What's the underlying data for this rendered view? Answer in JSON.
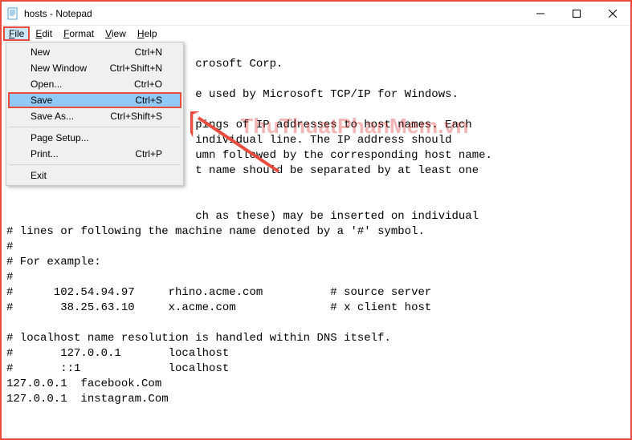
{
  "titlebar": {
    "title": "hosts - Notepad"
  },
  "menubar": {
    "file": "File",
    "edit": "Edit",
    "format": "Format",
    "view": "View",
    "help": "Help"
  },
  "dropdown": {
    "new_label": "New",
    "new_accel": "Ctrl+N",
    "newwin_label": "New Window",
    "newwin_accel": "Ctrl+Shift+N",
    "open_label": "Open...",
    "open_accel": "Ctrl+O",
    "save_label": "Save",
    "save_accel": "Ctrl+S",
    "saveas_label": "Save As...",
    "saveas_accel": "Ctrl+Shift+S",
    "pagesetup_label": "Page Setup...",
    "print_label": "Print...",
    "print_accel": "Ctrl+P",
    "exit_label": "Exit"
  },
  "content": {
    "text": "\n                            crosoft Corp.\n\n                            e used by Microsoft TCP/IP for Windows.\n\n                            pings of IP addresses to host names. Each\n                            individual line. The IP address should\n                            umn followed by the corresponding host name.\n                            t name should be separated by at least one\n\n\n                            ch as these) may be inserted on individual\n# lines or following the machine name denoted by a '#' symbol.\n#\n# For example:\n#\n#      102.54.94.97     rhino.acme.com          # source server\n#       38.25.63.10     x.acme.com              # x client host\n\n# localhost name resolution is handled within DNS itself.\n#       127.0.0.1       localhost\n#       ::1             localhost\n127.0.0.1  facebook.Com\n127.0.0.1  instagram.Com"
  },
  "watermark": "ThuThuatPhanMem.vn"
}
